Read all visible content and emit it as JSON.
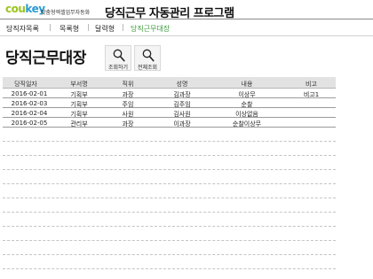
{
  "header": {
    "logo_part1": "cou",
    "logo_part2": "key",
    "tagline": "맞춤형엑셀업무자동화",
    "app_title": "당직근무 자동관리 프로그램"
  },
  "nav": {
    "items": [
      {
        "label": "당직자목록"
      },
      {
        "label": "목록형"
      },
      {
        "label": "달력형"
      },
      {
        "label": "당직근무대장",
        "active": true
      }
    ]
  },
  "page": {
    "title": "당직근무대장"
  },
  "toolbar": {
    "search_label": "조회하기",
    "all_search_label": "전체조회",
    "search_icon": "magnifier-icon"
  },
  "table": {
    "columns": [
      "당직일자",
      "부서명",
      "직위",
      "성명",
      "내용",
      "비고"
    ],
    "rows": [
      [
        "2016-02-01",
        "기획부",
        "과장",
        "김과장",
        "이상무",
        "비고1"
      ],
      [
        "2016-02-03",
        "기획부",
        "주임",
        "김주임",
        "순찰",
        ""
      ],
      [
        "2016-02-04",
        "기획부",
        "사원",
        "김사원",
        "이상없음",
        ""
      ],
      [
        "2016-02-05",
        "관리부",
        "과장",
        "이과장",
        "순찰이상무",
        ""
      ]
    ]
  },
  "colors": {
    "logo_green": "#9bc41d",
    "logo_blue": "#2a9bd6",
    "active_nav": "#3c9b3c",
    "table_header_bg": "#e2e2e2"
  }
}
